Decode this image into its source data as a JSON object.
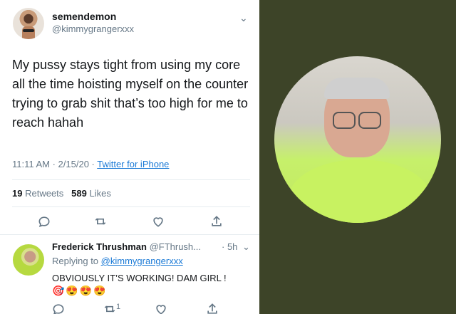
{
  "tweet": {
    "display_name": "semendemon",
    "handle": "@kimmygrangerxxx",
    "text": "My pussy stays tight from using my core all the time hoisting myself on the counter trying to grab shit that’s too high for me to reach hahah",
    "time": "11:11 AM · 2/15/20 · ",
    "source": "Twitter for iPhone",
    "retweets": "19",
    "retweets_label": "Retweets",
    "likes": "589",
    "likes_label": "Likes"
  },
  "reply": {
    "display_name": "Frederick Thrushman",
    "handle": "@FThrush...",
    "time": "· 5h",
    "replying_prefix": "Replying to ",
    "replying_to": "@kimmygrangerxxx",
    "text": "OBVIOUSLY IT’S WORKING! DAM GIRL !",
    "emojis": "🎯😍😍😍",
    "retweet_count": "1"
  },
  "colors": {
    "background_right": "#3d4428",
    "link": "#1b7ad6",
    "muted": "#657786"
  },
  "icons": [
    "chevron-down-icon",
    "reply-icon",
    "retweet-icon",
    "like-icon",
    "share-icon"
  ]
}
